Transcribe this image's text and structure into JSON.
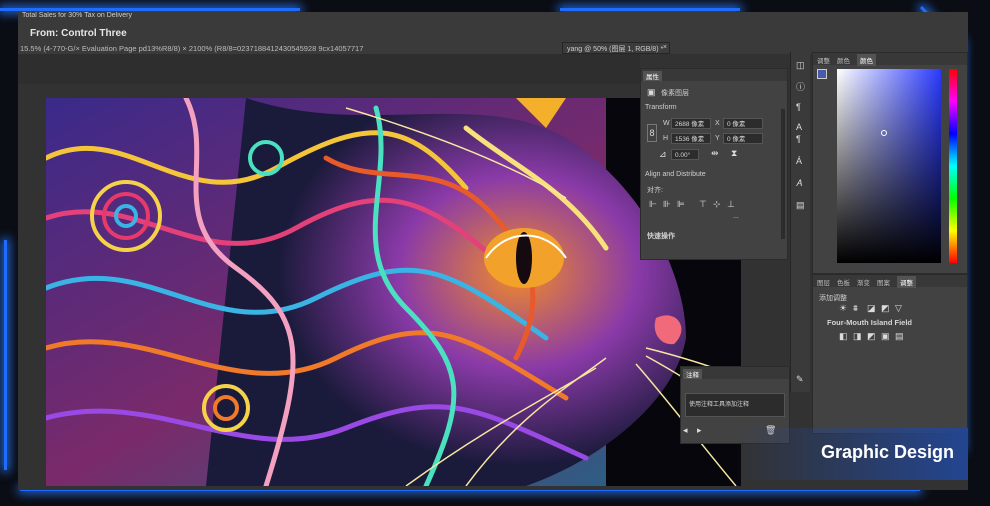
{
  "banner": {
    "promo": "Total Sales for 30% Tax on Delivery",
    "title": "From: Control Three",
    "status": "15.5% (4-770-G/× Evaluation Page pd13%R8/8) × 2100% (R8/8=0237188412430545928 9cx14057717"
  },
  "doc_tab": {
    "label": "yang @ 50% (图层 1, RGB/8) *",
    "close": "×"
  },
  "properties": {
    "title": "属性",
    "layer_type": "像素图层",
    "transform_title": "Transform",
    "w_label": "W",
    "w_value": "2688 像素",
    "x_label": "X",
    "x_value": "0 像素",
    "h_label": "H",
    "h_value": "1536 像素",
    "y_label": "Y",
    "y_value": "0 像素",
    "angle_value": "0.00°",
    "align_title": "Align and Distribute",
    "align_label": "对齐:",
    "more": "...",
    "quick_title": "快速操作"
  },
  "notes": {
    "title": "注释",
    "hint": "使用注释工具添加注释"
  },
  "color_panel": {
    "tabs": [
      "调整",
      "颜色",
      "颜色"
    ],
    "active": 2,
    "fg": "#4a5aa8",
    "bg": "#111111"
  },
  "adjust_panel": {
    "tabs": [
      "图层",
      "色板",
      "渐变",
      "图案",
      "调整"
    ],
    "active": 4,
    "title": "添加调整",
    "label": "Four-Mouth Island Field"
  },
  "badge": {
    "text": "Graphic Design"
  },
  "colors": {
    "accent": "#2a7bff",
    "panel": "#424242",
    "app": "#323232"
  }
}
